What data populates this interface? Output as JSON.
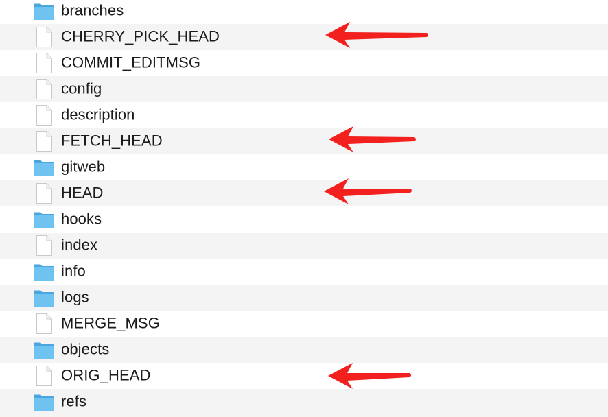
{
  "window": {
    "files": [
      {
        "name": "branches",
        "kind": "folder"
      },
      {
        "name": "CHERRY_PICK_HEAD",
        "kind": "file",
        "highlighted": true
      },
      {
        "name": "COMMIT_EDITMSG",
        "kind": "file"
      },
      {
        "name": "config",
        "kind": "file"
      },
      {
        "name": "description",
        "kind": "file"
      },
      {
        "name": "FETCH_HEAD",
        "kind": "file",
        "highlighted": true
      },
      {
        "name": "gitweb",
        "kind": "folder"
      },
      {
        "name": "HEAD",
        "kind": "file",
        "highlighted": true
      },
      {
        "name": "hooks",
        "kind": "folder"
      },
      {
        "name": "index",
        "kind": "file"
      },
      {
        "name": "info",
        "kind": "folder"
      },
      {
        "name": "logs",
        "kind": "folder"
      },
      {
        "name": "MERGE_MSG",
        "kind": "file"
      },
      {
        "name": "objects",
        "kind": "folder"
      },
      {
        "name": "ORIG_HEAD",
        "kind": "file",
        "highlighted": true
      },
      {
        "name": "refs",
        "kind": "folder"
      }
    ]
  },
  "colors": {
    "folder_icon": "#5cb8ec",
    "annotation_arrow": "#f2211e",
    "row_stripe": "#f4f4f5"
  },
  "icons": {
    "folder": "folder-icon",
    "file": "document-icon",
    "annotation": "red-arrow-icon"
  }
}
